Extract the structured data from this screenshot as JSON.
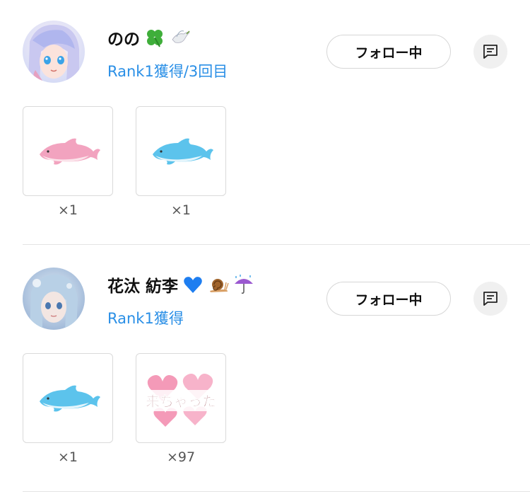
{
  "entries": [
    {
      "name": "のの",
      "name_emojis": [
        "four-leaf-clover-emoji",
        "dove-emoji"
      ],
      "rank": "Rank1獲得/3回目",
      "follow_label": "フォロー中",
      "gifts": [
        {
          "icon": "pink-dolphin-gift-icon",
          "count": "×1"
        },
        {
          "icon": "blue-dolphin-gift-icon",
          "count": "×1"
        }
      ]
    },
    {
      "name": "花汰 紡李",
      "name_emojis": [
        "blue-heart-emoji",
        "snail-emoji",
        "umbrella-rain-emoji"
      ],
      "rank": "Rank1獲得",
      "follow_label": "フォロー中",
      "gifts": [
        {
          "icon": "blue-dolphin-gift-icon",
          "count": "×1"
        },
        {
          "icon": "kichatta-hearts-sticker-icon",
          "count": "×97",
          "sticker_text": "来ちゃった"
        }
      ]
    }
  ],
  "colors": {
    "rank_text": "#2a8fe6",
    "button_border": "#d6d6d6",
    "msg_bg": "#f0f0f0"
  }
}
